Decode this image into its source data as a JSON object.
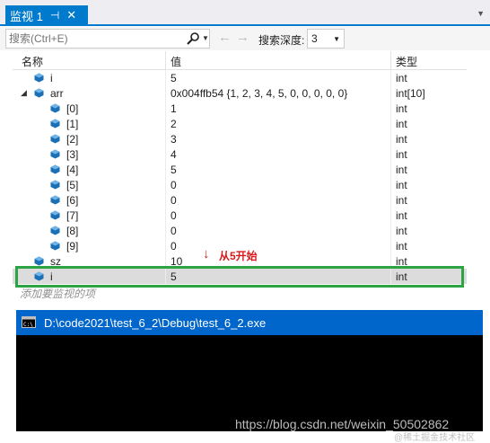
{
  "window": {
    "tab_title": "监视 1",
    "pin_glyph": "⊣",
    "close_glyph": "✕",
    "dropdown_glyph": "▼"
  },
  "toolbar": {
    "search_placeholder": "搜索(Ctrl+E)",
    "depth_label": "搜索深度:",
    "depth_value": "3",
    "back_glyph": "←",
    "forward_glyph": "→"
  },
  "columns": {
    "name": "名称",
    "value": "值",
    "type": "类型"
  },
  "rows": [
    {
      "name": "i",
      "value": "5",
      "type": "int"
    },
    {
      "name": "arr",
      "value": "0x004ffb54 {1, 2, 3, 4, 5, 0, 0, 0, 0, 0}",
      "type": "int[10]"
    },
    {
      "name": "[0]",
      "value": "1",
      "type": "int"
    },
    {
      "name": "[1]",
      "value": "2",
      "type": "int"
    },
    {
      "name": "[2]",
      "value": "3",
      "type": "int"
    },
    {
      "name": "[3]",
      "value": "4",
      "type": "int"
    },
    {
      "name": "[4]",
      "value": "5",
      "type": "int"
    },
    {
      "name": "[5]",
      "value": "0",
      "type": "int"
    },
    {
      "name": "[6]",
      "value": "0",
      "type": "int"
    },
    {
      "name": "[7]",
      "value": "0",
      "type": "int"
    },
    {
      "name": "[8]",
      "value": "0",
      "type": "int"
    },
    {
      "name": "[9]",
      "value": "0",
      "type": "int"
    },
    {
      "name": "sz",
      "value": "10",
      "type": "int"
    },
    {
      "name": "i",
      "value": "5",
      "type": "int"
    }
  ],
  "add_hint": "添加要监视的项",
  "annotation": {
    "arrow": "↓",
    "text": "从5开始"
  },
  "console": {
    "path": "D:\\code2021\\test_6_2\\Debug\\test_6_2.exe"
  },
  "watermark": "https://blog.csdn.net/weixin_50502862",
  "watermark2": "@稀土掘金技术社区",
  "colors": {
    "accent": "#007acc",
    "highlight_border": "#2da444",
    "annotation": "#d7191c",
    "console_title": "#0066cc"
  }
}
